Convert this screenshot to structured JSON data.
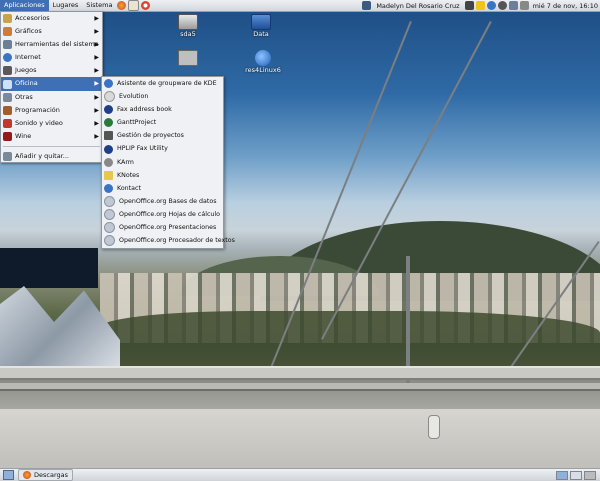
{
  "top_panel": {
    "menus": [
      {
        "label": "Aplicaciones",
        "active": true
      },
      {
        "label": "Lugares",
        "active": false
      },
      {
        "label": "Sistema",
        "active": false
      }
    ],
    "launchers": [
      "firefox-icon",
      "mail-icon",
      "help-icon"
    ],
    "user": "Madelyn Del Rosario Cruz",
    "clock": "mié  7 de nov, 16:10"
  },
  "desktop_icons": [
    {
      "name": "drive-icon",
      "label": "sda5"
    },
    {
      "name": "data-drive-icon",
      "label": "Data"
    },
    {
      "name": "folder-icon",
      "label": ""
    },
    {
      "name": "network-icon",
      "label": "res4Linux6"
    }
  ],
  "main_menu": {
    "items": [
      {
        "label": "Accesorios",
        "icon": "accessories-icon",
        "color": "#c9a24a"
      },
      {
        "label": "Gráficos",
        "icon": "graphics-icon",
        "color": "#d77a2e"
      },
      {
        "label": "Herramientas del sistema",
        "icon": "system-tools-icon",
        "color": "#6b7f99"
      },
      {
        "label": "Internet",
        "icon": "internet-icon",
        "color": "#3b74c4"
      },
      {
        "label": "Juegos",
        "icon": "games-icon",
        "color": "#5a5a5a"
      },
      {
        "label": "Oficina",
        "icon": "office-icon",
        "color": "#4f80c6",
        "selected": true
      },
      {
        "label": "Otras",
        "icon": "other-icon",
        "color": "#7a8a9a"
      },
      {
        "label": "Programación",
        "icon": "programming-icon",
        "color": "#a35c2a"
      },
      {
        "label": "Sonido y video",
        "icon": "multimedia-icon",
        "color": "#c0392b"
      },
      {
        "label": "Wine",
        "icon": "wine-icon",
        "color": "#8c1d18"
      }
    ],
    "footer": {
      "label": "Añadir y quitar...",
      "icon": "add-remove-icon",
      "color": "#7a8a9a"
    }
  },
  "office_submenu": {
    "items": [
      {
        "label": "Asistente de groupware de KDE",
        "icon": "kde-wizard-icon",
        "color": "#3b74c4"
      },
      {
        "label": "Evolution",
        "icon": "evolution-icon",
        "color": "#d9d9d9"
      },
      {
        "label": "Fax address book",
        "icon": "fax-addressbook-icon",
        "color": "#1f3f8a"
      },
      {
        "label": "GanttProject",
        "icon": "gantt-icon",
        "color": "#2b7a3a"
      },
      {
        "label": "Gestión de proyectos",
        "icon": "project-icon",
        "color": "#555555"
      },
      {
        "label": "HPLIP Fax Utility",
        "icon": "hplip-fax-icon",
        "color": "#1f3f8a"
      },
      {
        "label": "KArm",
        "icon": "karm-icon",
        "color": "#888888"
      },
      {
        "label": "KNotes",
        "icon": "knotes-icon",
        "color": "#e8c84a"
      },
      {
        "label": "Kontact",
        "icon": "kontact-icon",
        "color": "#3b74c4"
      },
      {
        "label": "OpenOffice.org Bases de datos",
        "icon": "ooo-base-icon",
        "color": "#c0c8d4"
      },
      {
        "label": "OpenOffice.org Hojas de cálculo",
        "icon": "ooo-calc-icon",
        "color": "#c0c8d4"
      },
      {
        "label": "OpenOffice.org Presentaciones",
        "icon": "ooo-impress-icon",
        "color": "#c0c8d4"
      },
      {
        "label": "OpenOffice.org Procesador de textos",
        "icon": "ooo-writer-icon",
        "color": "#c0c8d4"
      }
    ]
  },
  "bottom_panel": {
    "task": "Descargas"
  }
}
